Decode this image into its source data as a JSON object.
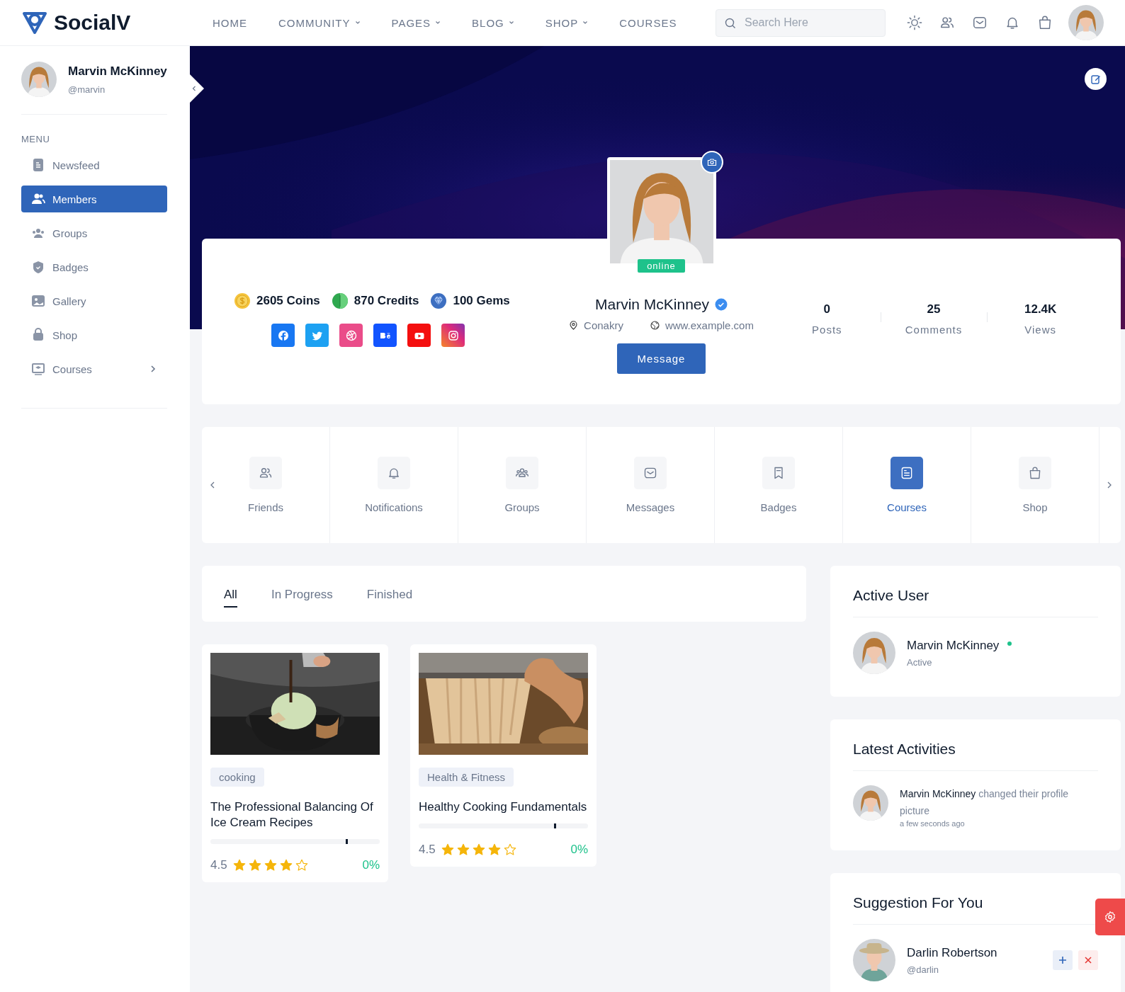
{
  "header": {
    "logo": "SocialV",
    "nav": [
      {
        "label": "HOME",
        "dropdown": false
      },
      {
        "label": "COMMUNITY",
        "dropdown": true
      },
      {
        "label": "PAGES",
        "dropdown": true
      },
      {
        "label": "BLOG",
        "dropdown": true
      },
      {
        "label": "SHOP",
        "dropdown": true
      },
      {
        "label": "COURSES",
        "dropdown": false
      }
    ],
    "search": {
      "placeholder": "Search Here"
    }
  },
  "sidebar": {
    "user": {
      "name": "Marvin McKinney",
      "handle": "@marvin"
    },
    "menu_title": "MENU",
    "items": [
      {
        "label": "Newsfeed",
        "selected": false,
        "kind": "link"
      },
      {
        "label": "Members",
        "selected": true,
        "kind": "link"
      },
      {
        "label": "Groups",
        "selected": false,
        "kind": "link"
      },
      {
        "label": "Badges",
        "selected": false,
        "kind": "link"
      },
      {
        "label": "Gallery",
        "selected": false,
        "kind": "link"
      },
      {
        "label": "Shop",
        "selected": false,
        "kind": "link"
      },
      {
        "label": "Courses",
        "selected": false,
        "kind": "submenu"
      }
    ]
  },
  "profile": {
    "status": "online",
    "name": "Marvin McKinney",
    "verified": true,
    "location": "Conakry",
    "website": "www.example.com",
    "button": "Message",
    "currencies": [
      "2605 Coins",
      "870 Credits",
      "100 Gems"
    ],
    "stats": [
      {
        "value": "0",
        "label": "Posts"
      },
      {
        "value": "25",
        "label": "Comments"
      },
      {
        "value": "12.4K",
        "label": "Views"
      }
    ]
  },
  "sections": [
    {
      "label": "Friends",
      "selected": false
    },
    {
      "label": "Notifications",
      "selected": false
    },
    {
      "label": "Groups",
      "selected": false
    },
    {
      "label": "Messages",
      "selected": false
    },
    {
      "label": "Badges",
      "selected": false
    },
    {
      "label": "Courses",
      "selected": true
    },
    {
      "label": "Shop",
      "selected": false
    }
  ],
  "course_tabs": [
    {
      "label": "All",
      "selected": true
    },
    {
      "label": "In Progress",
      "selected": false
    },
    {
      "label": "Finished",
      "selected": false
    }
  ],
  "courses": [
    {
      "tag": "cooking",
      "title": "The Professional Balancing Of Ice Cream Recipes",
      "level": 0.8,
      "rating": "4.5",
      "stars": 4,
      "progress": "0%"
    },
    {
      "tag": "Health & Fitness",
      "title": "Healthy Cooking Fundamentals",
      "level": 0.8,
      "rating": "4.5",
      "stars": 4,
      "progress": "0%"
    }
  ],
  "active_user": {
    "title": "Active User",
    "name": "Marvin McKinney",
    "online": true,
    "status": "Active"
  },
  "activities": {
    "title": "Latest Activities",
    "items": [
      {
        "text": "**Marvin McKinney** changed their profile picture",
        "time": "a few seconds ago"
      }
    ]
  },
  "suggestions": {
    "title": "Suggestion For You",
    "items": [
      {
        "name": "Darlin Robertson",
        "handle": "@darlin"
      }
    ]
  }
}
